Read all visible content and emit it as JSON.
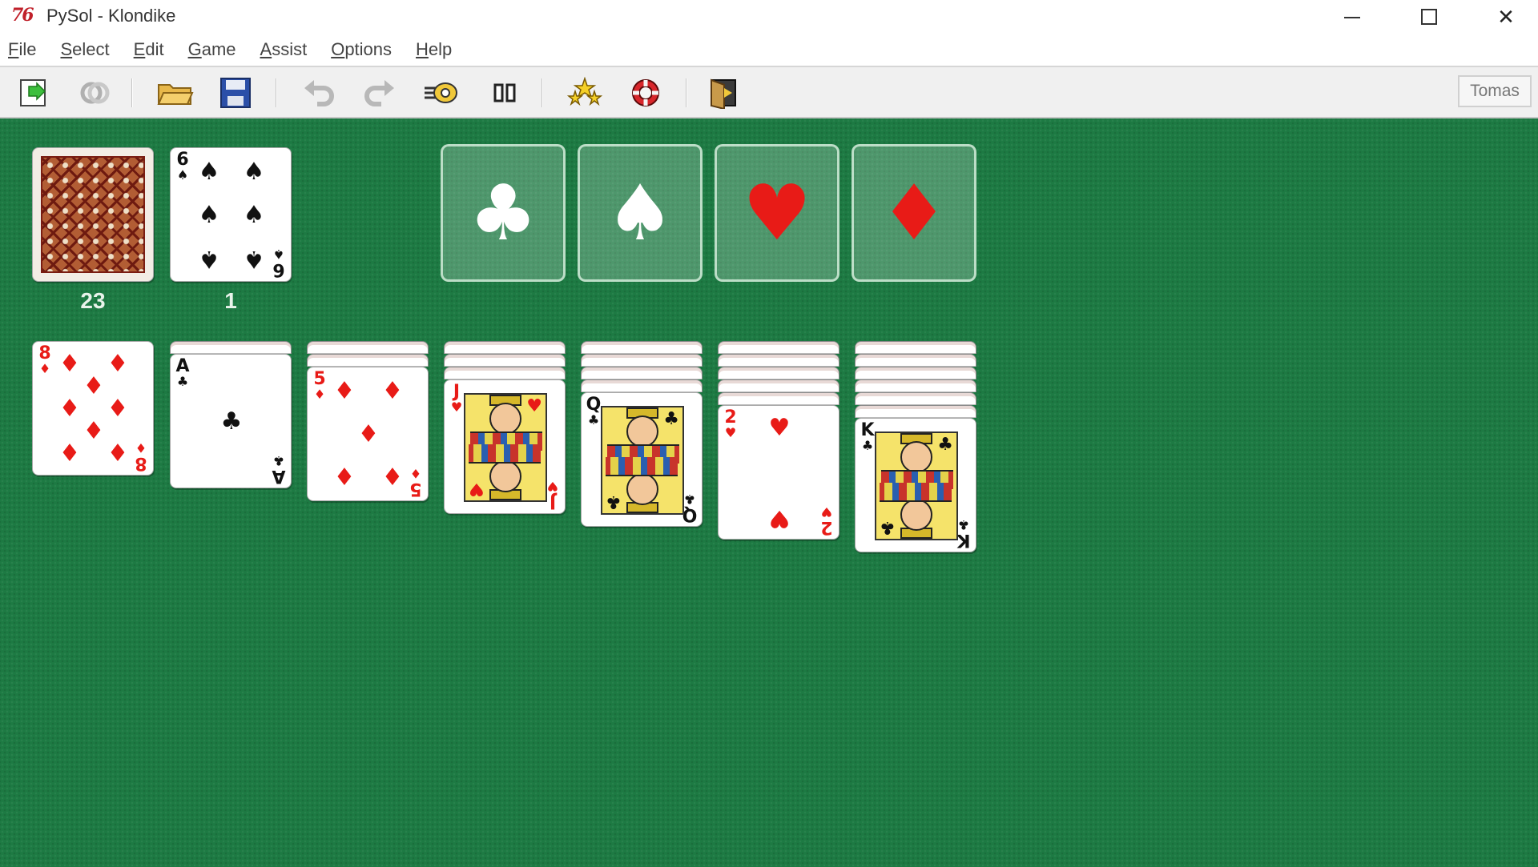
{
  "window": {
    "logo": "76",
    "title": "PySol - Klondike",
    "controls": {
      "minimize": "minimize",
      "maximize": "maximize",
      "close": "✕"
    }
  },
  "menu": [
    {
      "label_ul": "F",
      "label_rest": "ile"
    },
    {
      "label_ul": "S",
      "label_rest": "elect"
    },
    {
      "label_ul": "E",
      "label_rest": "dit"
    },
    {
      "label_ul": "G",
      "label_rest": "ame"
    },
    {
      "label_ul": "A",
      "label_rest": "ssist"
    },
    {
      "label_ul": "O",
      "label_rest": "ptions"
    },
    {
      "label_ul": "H",
      "label_rest": "elp"
    }
  ],
  "toolbar": {
    "buttons": [
      "new-game-icon",
      "restart-icon",
      "open-icon",
      "save-icon",
      "undo-icon",
      "redo-icon",
      "autodrop-icon",
      "pause-icon",
      "statistics-icon",
      "rules-icon",
      "quit-icon"
    ],
    "player": "Tomas"
  },
  "colors": {
    "table": "#1d7a43",
    "red_suit": "#e81b17",
    "black_suit": "#111111",
    "foundation_border": "#e1f5e6"
  },
  "stock": {
    "count": "23"
  },
  "waste": {
    "count": "1",
    "card": {
      "rank": "6",
      "suit": "♠",
      "color": "black"
    }
  },
  "foundations": [
    {
      "suit": "♣",
      "color": "white"
    },
    {
      "suit": "♠",
      "color": "white"
    },
    {
      "suit": "♥",
      "color": "red"
    },
    {
      "suit": "♦",
      "color": "red"
    }
  ],
  "tableau": [
    {
      "hidden": 0,
      "top": {
        "rank": "8",
        "suit": "♦",
        "color": "red"
      }
    },
    {
      "hidden": 1,
      "top": {
        "rank": "A",
        "suit": "♣",
        "color": "black"
      }
    },
    {
      "hidden": 2,
      "top": {
        "rank": "5",
        "suit": "♦",
        "color": "red"
      }
    },
    {
      "hidden": 3,
      "top": {
        "rank": "J",
        "suit": "♥",
        "color": "red"
      }
    },
    {
      "hidden": 4,
      "top": {
        "rank": "Q",
        "suit": "♣",
        "color": "black"
      }
    },
    {
      "hidden": 5,
      "top": {
        "rank": "2",
        "suit": "♥",
        "color": "red"
      }
    },
    {
      "hidden": 6,
      "top": {
        "rank": "K",
        "suit": "♣",
        "color": "black"
      }
    }
  ]
}
